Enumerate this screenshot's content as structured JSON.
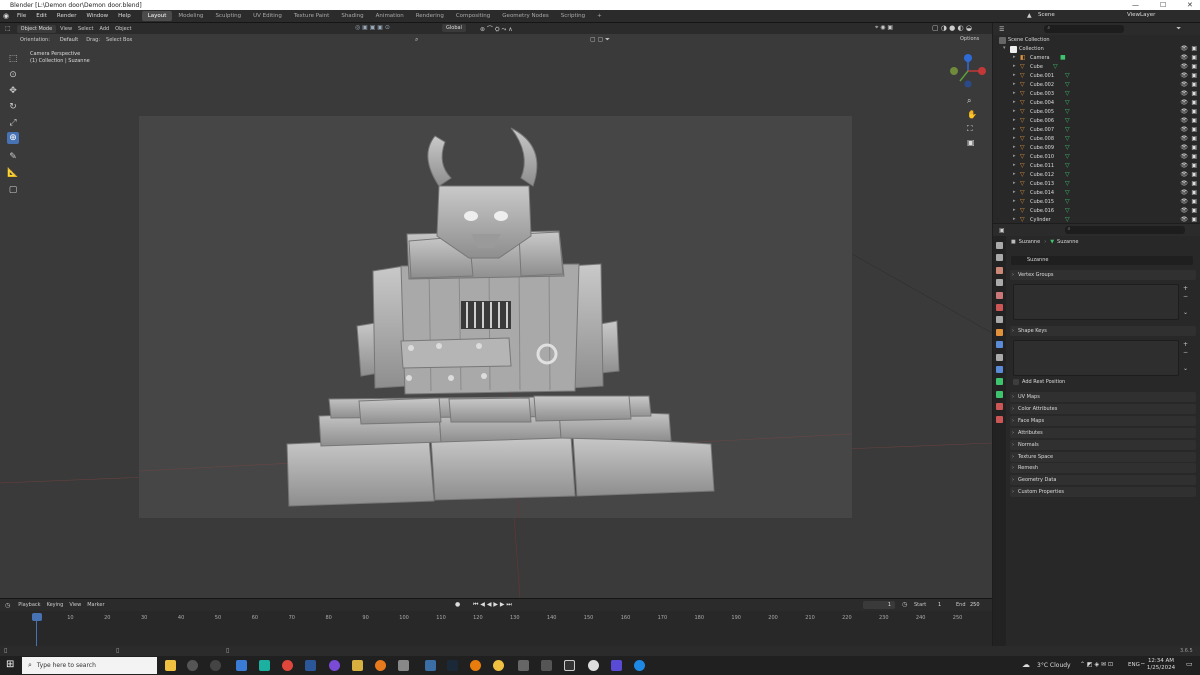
{
  "window": {
    "title": "Blender [L:\\Demon door\\Demon door.blend]"
  },
  "menu": [
    "File",
    "Edit",
    "Render",
    "Window",
    "Help"
  ],
  "workspaces": [
    "Layout",
    "Modeling",
    "Sculpting",
    "UV Editing",
    "Texture Paint",
    "Shading",
    "Animation",
    "Rendering",
    "Compositing",
    "Geometry Nodes",
    "Scripting"
  ],
  "active_workspace": "Layout",
  "scene": "Scene",
  "view_layer": "ViewLayer",
  "viewport_header": {
    "mode": "Object Mode",
    "menus": [
      "View",
      "Select",
      "Add",
      "Object"
    ],
    "transform": "Global",
    "orientation_label": "Orientation:",
    "orientation": "Default",
    "drag_label": "Drag:",
    "drag": "Select Box",
    "options": "Options"
  },
  "viewport_info": {
    "line1": "Camera Perspective",
    "line2": "(1) Collection | Suzanne"
  },
  "outliner": {
    "root": "Scene Collection",
    "collection": "Collection",
    "items": [
      "Camera",
      "Cube",
      "Cube.001",
      "Cube.002",
      "Cube.003",
      "Cube.004",
      "Cube.005",
      "Cube.006",
      "Cube.007",
      "Cube.008",
      "Cube.009",
      "Cube.010",
      "Cube.011",
      "Cube.012",
      "Cube.013",
      "Cube.014",
      "Cube.015",
      "Cube.016",
      "Cylinder"
    ]
  },
  "properties": {
    "breadcrumb_object": "Suzanne",
    "breadcrumb_data": "Suzanne",
    "data_name": "Suzanne",
    "vertex_groups": "Vertex Groups",
    "shape_keys": "Shape Keys",
    "add_rest_position": "Add Rest Position",
    "panels": [
      "UV Maps",
      "Color Attributes",
      "Face Maps",
      "Attributes",
      "Normals",
      "Texture Space",
      "Remesh",
      "Geometry Data",
      "Custom Properties"
    ]
  },
  "timeline": {
    "menus": [
      "Playback",
      "Keying",
      "View",
      "Marker"
    ],
    "current_frame": "1",
    "start_label": "Start",
    "start": "1",
    "end_label": "End",
    "end": "250",
    "ticks": [
      "1",
      "10",
      "20",
      "30",
      "40",
      "50",
      "60",
      "70",
      "80",
      "90",
      "100",
      "110",
      "120",
      "130",
      "140",
      "150",
      "160",
      "170",
      "180",
      "190",
      "200",
      "210",
      "220",
      "230",
      "240",
      "250"
    ]
  },
  "status": {
    "version": "3.6.5"
  },
  "taskbar": {
    "search_placeholder": "Type here to search",
    "weather": "3°C  Cloudy",
    "lang": "ENG",
    "time": "12:34 AM",
    "date": "1/25/2024"
  },
  "colors": {
    "accent": "#4772b3",
    "mesh_orange": "#e0913a",
    "mesh_green": "#3ec46d"
  }
}
